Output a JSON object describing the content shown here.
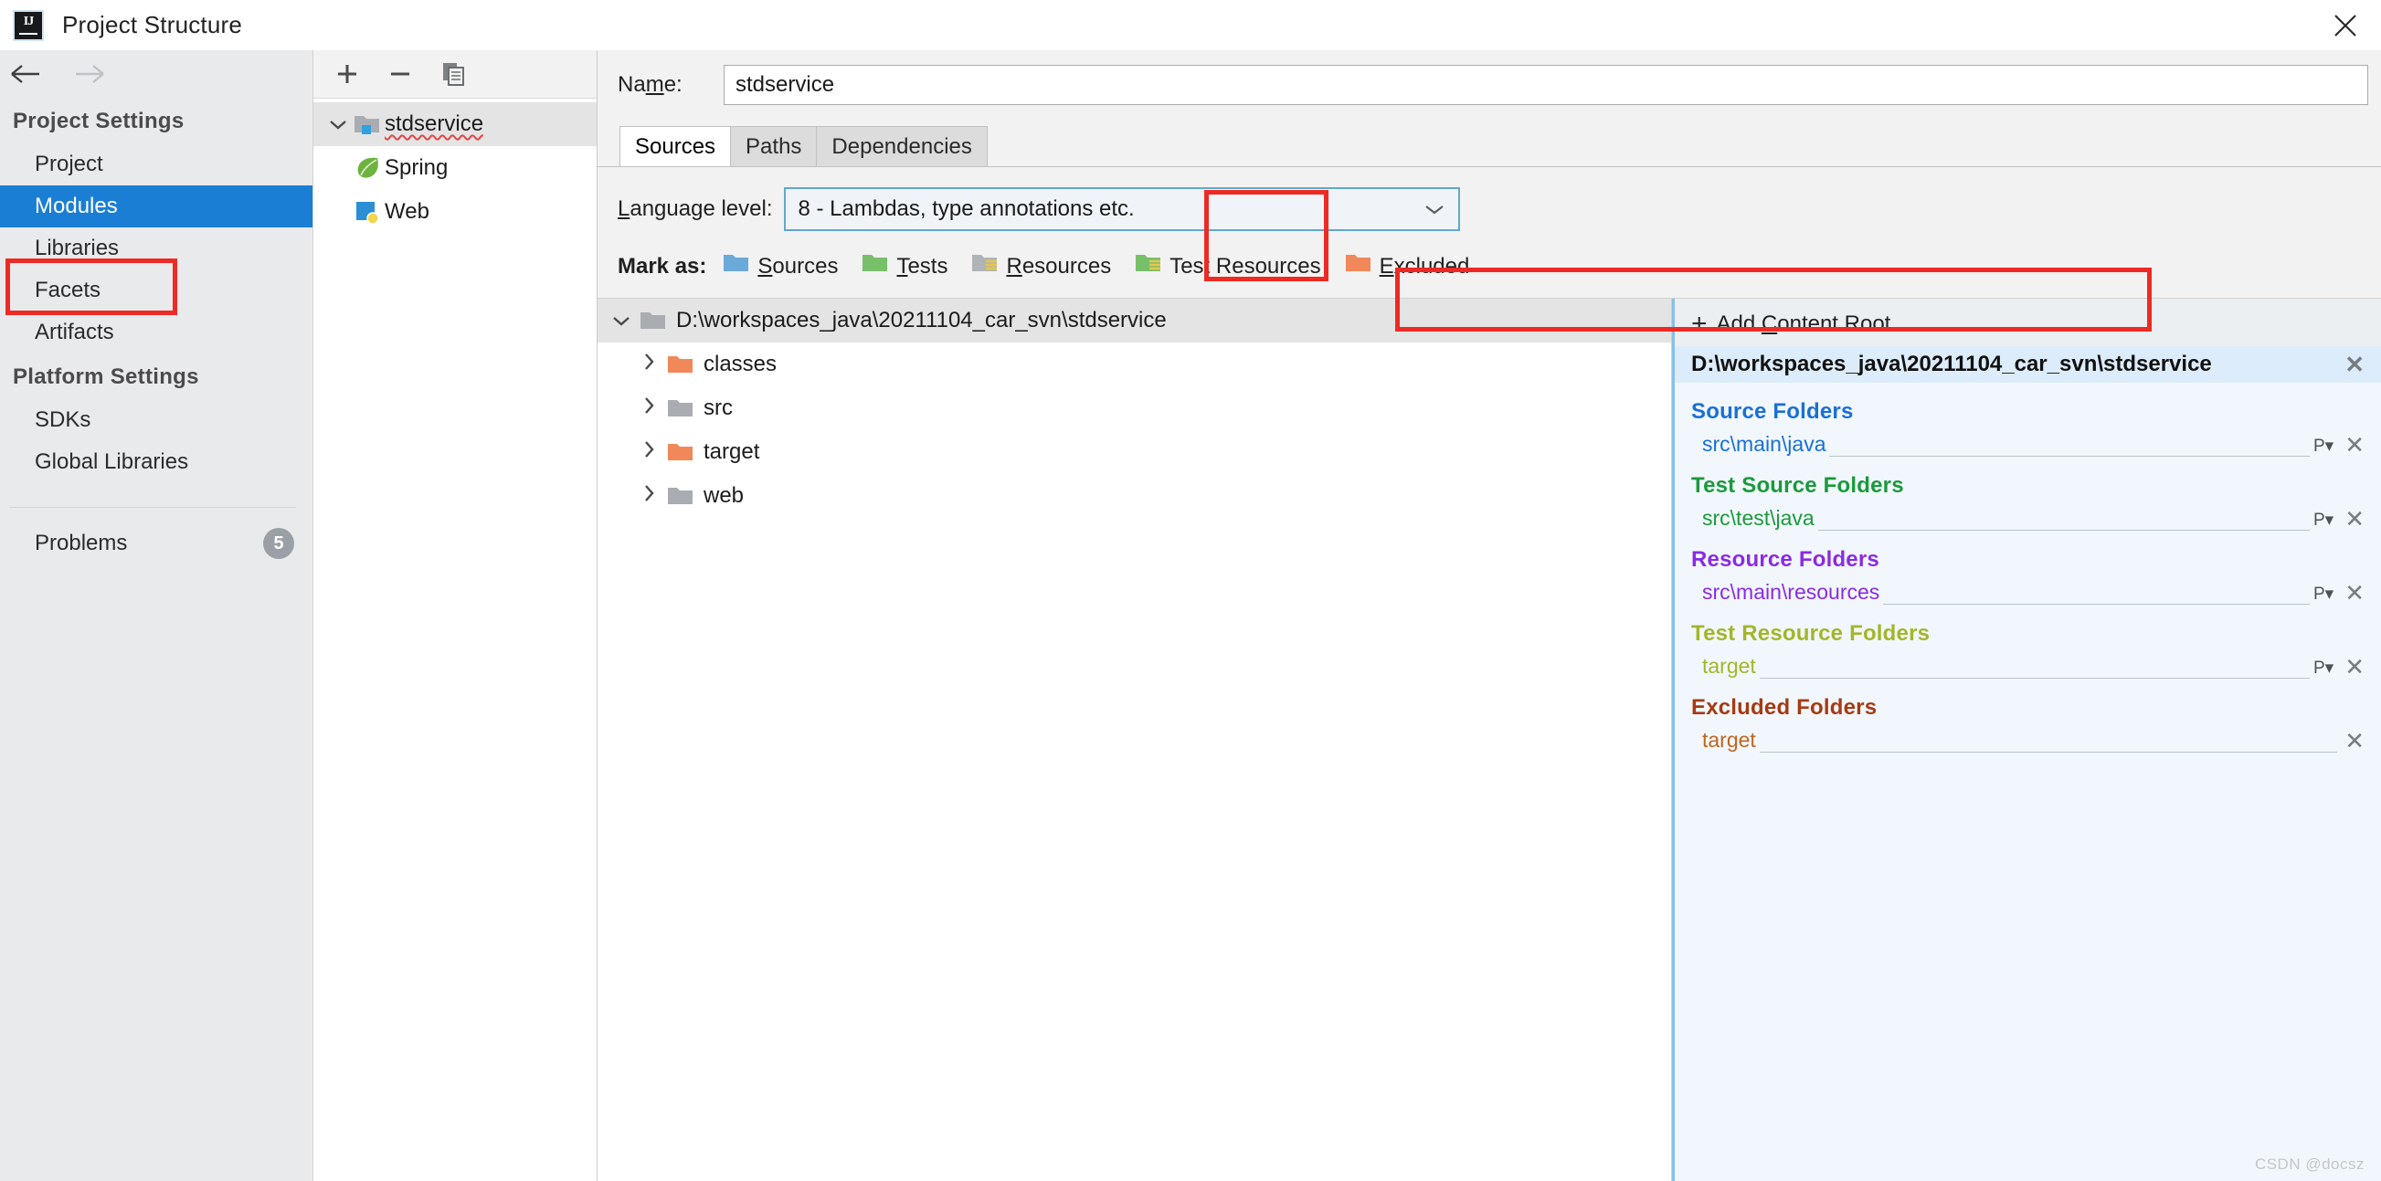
{
  "window": {
    "title": "Project Structure",
    "logo_icon": "intellij-idea-logo",
    "close_icon": "close-icon"
  },
  "sidebar": {
    "back_icon": "arrow-left-icon",
    "forward_icon": "arrow-right-icon",
    "project_settings_header": "Project Settings",
    "project_items": [
      {
        "label": "Project",
        "selected": false
      },
      {
        "label": "Modules",
        "selected": true
      },
      {
        "label": "Libraries",
        "selected": false
      },
      {
        "label": "Facets",
        "selected": false
      },
      {
        "label": "Artifacts",
        "selected": false
      }
    ],
    "platform_settings_header": "Platform Settings",
    "platform_items": [
      {
        "label": "SDKs",
        "selected": false
      },
      {
        "label": "Global Libraries",
        "selected": false
      }
    ],
    "problems": {
      "label": "Problems",
      "count": "5"
    }
  },
  "module_panel": {
    "toolbar": {
      "add_icon": "plus-icon",
      "remove_icon": "minus-icon",
      "copy_icon": "copy-icon"
    },
    "tree": [
      {
        "label": "stdservice",
        "icon": "module-folder-icon",
        "level": 0,
        "expanded": true,
        "selected": true,
        "misspelled": true
      },
      {
        "label": "Spring",
        "icon": "spring-leaf-icon",
        "level": 1,
        "expanded": false,
        "selected": false,
        "misspelled": false
      },
      {
        "label": "Web",
        "icon": "web-facet-icon",
        "level": 1,
        "expanded": false,
        "selected": false,
        "misspelled": false
      }
    ]
  },
  "editor": {
    "name_label_prefix": "Na",
    "name_label_mnemonic": "m",
    "name_label_suffix": "e:",
    "name_value": "stdservice",
    "tabs": [
      {
        "label": "Sources",
        "active": true
      },
      {
        "label": "Paths",
        "active": false
      },
      {
        "label": "Dependencies",
        "active": false
      }
    ],
    "language_level": {
      "label_mnemonic": "L",
      "label_rest": "anguage level:",
      "value": "8 - Lambdas, type annotations etc.",
      "chevron_icon": "chevron-down-icon"
    },
    "mark_as": {
      "label": "Mark as:",
      "options": [
        {
          "mnemonic": "S",
          "rest": "ources",
          "icon": "folder-sources-icon",
          "color": "#6aa9d8"
        },
        {
          "mnemonic": "T",
          "rest": "ests",
          "icon": "folder-tests-icon",
          "color": "#78bf6a"
        },
        {
          "mnemonic": "R",
          "rest": "esources",
          "icon": "folder-resources-icon",
          "color": "#b0b4b8"
        },
        {
          "mnemonic": "",
          "rest": "Test Resources",
          "icon": "folder-test-resources-icon",
          "color": "#78bf6a"
        },
        {
          "mnemonic": "E",
          "rest": "xcluded",
          "icon": "folder-excluded-icon",
          "color": "#f0885a"
        }
      ]
    },
    "file_tree": [
      {
        "label": "D:\\workspaces_java\\20211104_car_svn\\stdservice",
        "level": 0,
        "expanded": true,
        "selected": true,
        "color": "#a9adb1"
      },
      {
        "label": "classes",
        "level": 1,
        "expanded": false,
        "selected": false,
        "color": "#f0885a"
      },
      {
        "label": "src",
        "level": 1,
        "expanded": false,
        "selected": false,
        "color": "#a9adb1"
      },
      {
        "label": "target",
        "level": 1,
        "expanded": false,
        "selected": false,
        "color": "#f0885a"
      },
      {
        "label": "web",
        "level": 1,
        "expanded": false,
        "selected": false,
        "color": "#a9adb1"
      }
    ]
  },
  "roots_panel": {
    "add_content_root": {
      "plus_icon": "plus-icon",
      "prefix": "Add ",
      "mnemonic": "C",
      "suffix": "ontent Root"
    },
    "content_root_path": "D:\\workspaces_java\\20211104_car_svn\\stdservice",
    "remove_root_icon": "close-icon",
    "groups": [
      {
        "title": "Source Folders",
        "color": "#1a6fd4",
        "entries": [
          {
            "name": "src\\main\\java",
            "has_package_prefix": true,
            "package_prefix_label": "P",
            "remove_label": "✕"
          }
        ]
      },
      {
        "title": "Test Source Folders",
        "color": "#1a9a3c",
        "entries": [
          {
            "name": "src\\test\\java",
            "has_package_prefix": true,
            "package_prefix_label": "P",
            "remove_label": "✕"
          }
        ]
      },
      {
        "title": "Resource Folders",
        "color": "#8a2be2",
        "entries": [
          {
            "name": "src\\main\\resources",
            "has_package_prefix": true,
            "package_prefix_label": "P",
            "remove_label": "✕"
          }
        ]
      },
      {
        "title": "Test Resource Folders",
        "color": "#a3b62a",
        "entries": [
          {
            "name": "target",
            "has_package_prefix": true,
            "package_prefix_label": "P",
            "remove_label": "✕"
          }
        ]
      },
      {
        "title": "Excluded Folders",
        "color": "#a63a12",
        "entries": [
          {
            "name": "target",
            "has_package_prefix": false,
            "package_prefix_label": "",
            "remove_label": "✕"
          }
        ]
      }
    ]
  },
  "watermark": "CSDN @docsz",
  "annotation_color": "#ee2a24"
}
